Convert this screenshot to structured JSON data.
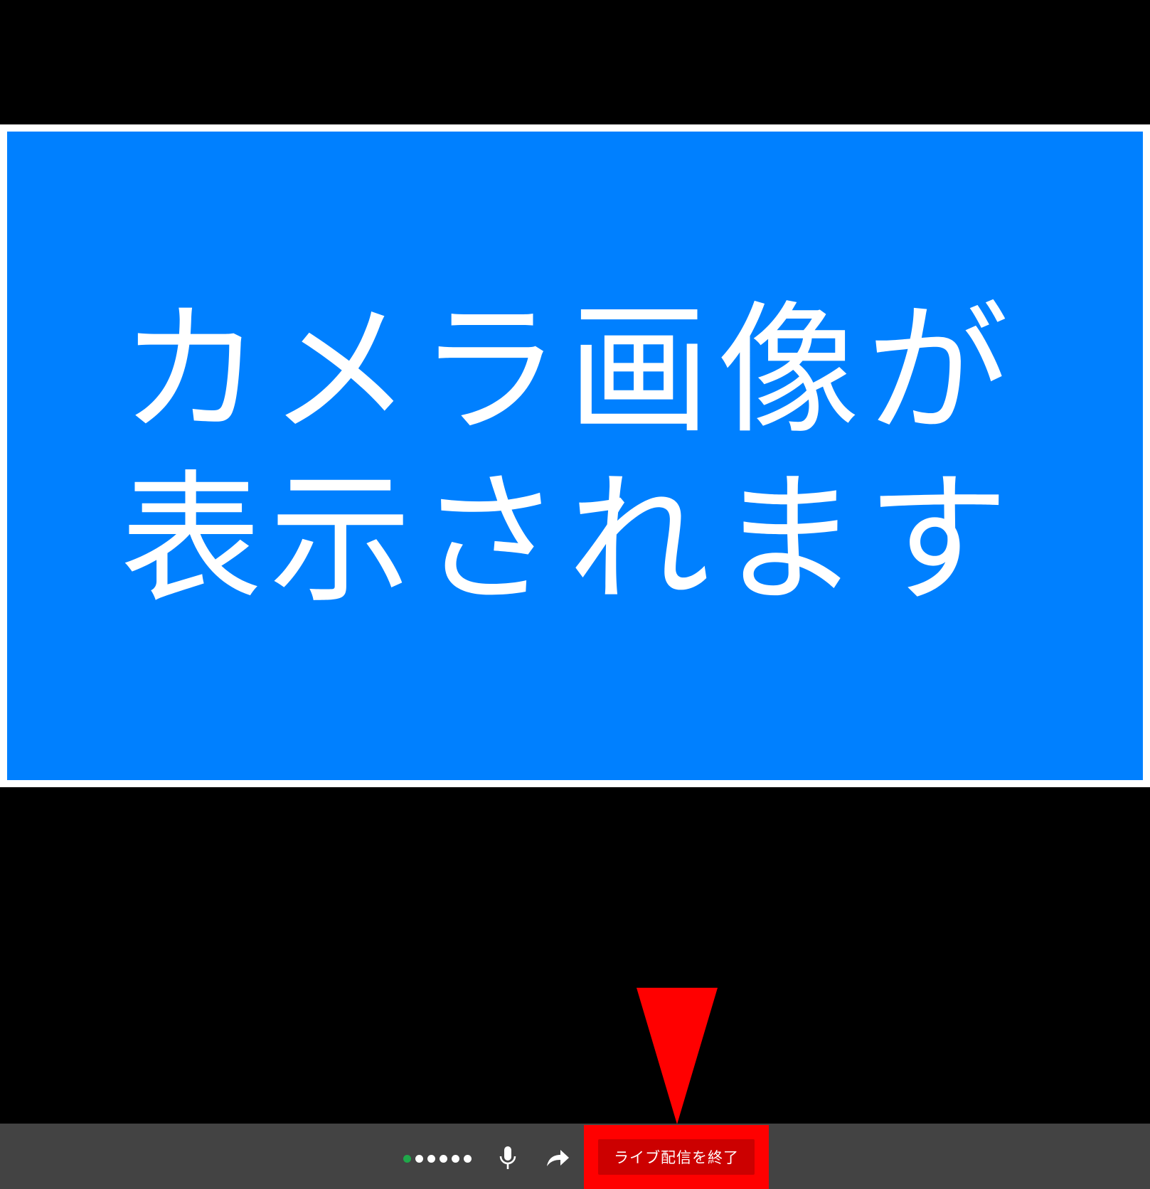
{
  "camera": {
    "placeholder_text": "カメラ画像が\n表示されます",
    "preview_color": "#0080ff"
  },
  "status": {
    "dots": [
      {
        "state": "active",
        "color": "#1fa84a"
      },
      {
        "state": "inactive",
        "color": "#ffffff"
      },
      {
        "state": "inactive",
        "color": "#ffffff"
      },
      {
        "state": "inactive",
        "color": "#ffffff"
      },
      {
        "state": "inactive",
        "color": "#ffffff"
      },
      {
        "state": "inactive",
        "color": "#ffffff"
      }
    ]
  },
  "controls": {
    "mic_icon": "microphone-icon",
    "share_icon": "share-arrow-icon",
    "end_live_label": "ライブ配信を終了",
    "end_live_color": "#cc0000"
  },
  "annotation": {
    "highlight_color": "#ff0000",
    "arrow_color": "#ff0000"
  }
}
